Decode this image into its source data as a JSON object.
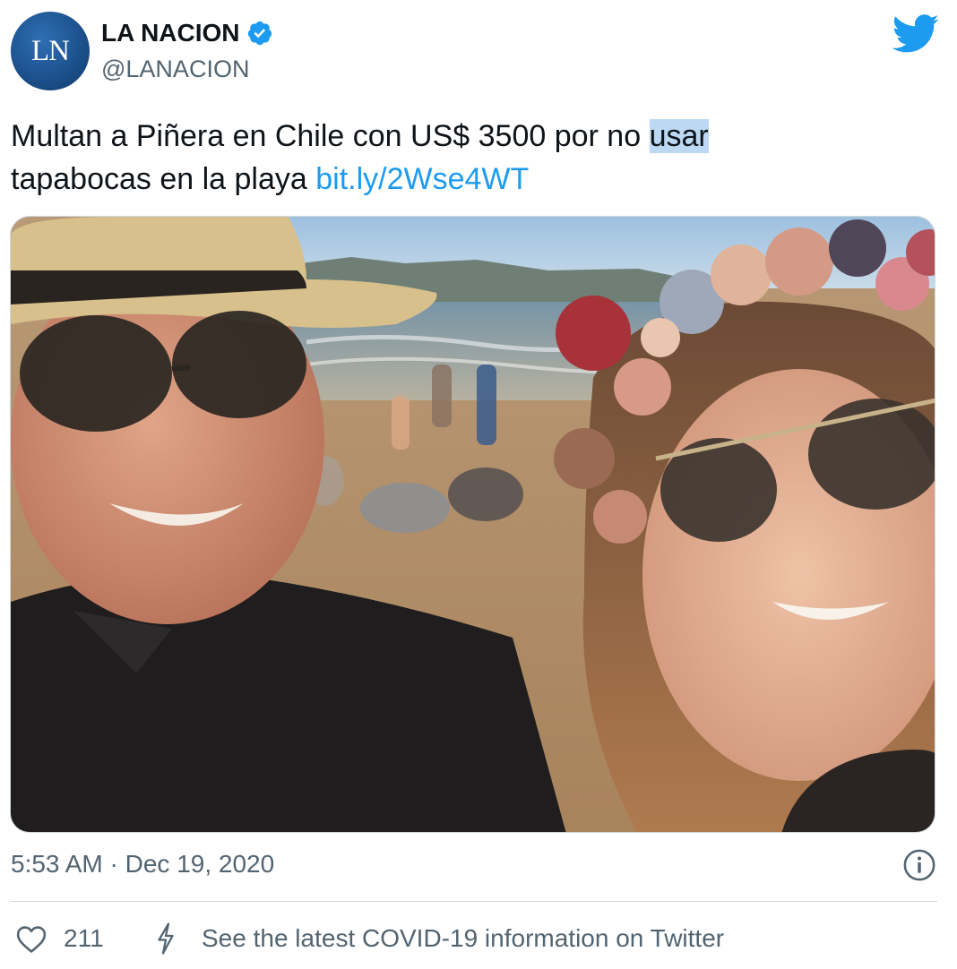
{
  "author": {
    "avatar_text": "LN",
    "display_name": "LA NACION",
    "handle": "@LANACION",
    "verified": true
  },
  "tweet": {
    "text_part1": "Multan a Piñera en Chile con US$ 3500 por no ",
    "text_highlight": "usar",
    "text_part2": "tapabocas en la playa ",
    "link": "bit.ly/2Wse4WT"
  },
  "media": {
    "description_icon": "photo"
  },
  "meta": {
    "time": "5:53 AM",
    "separator": " · ",
    "date": "Dec 19, 2020"
  },
  "actions": {
    "like_count": "211",
    "covid_info": "See the latest COVID-19 information on Twitter"
  },
  "colors": {
    "accent": "#1d9bf0",
    "text": "#0f1419",
    "secondary": "#536471",
    "highlight": "#bcd8f2"
  }
}
